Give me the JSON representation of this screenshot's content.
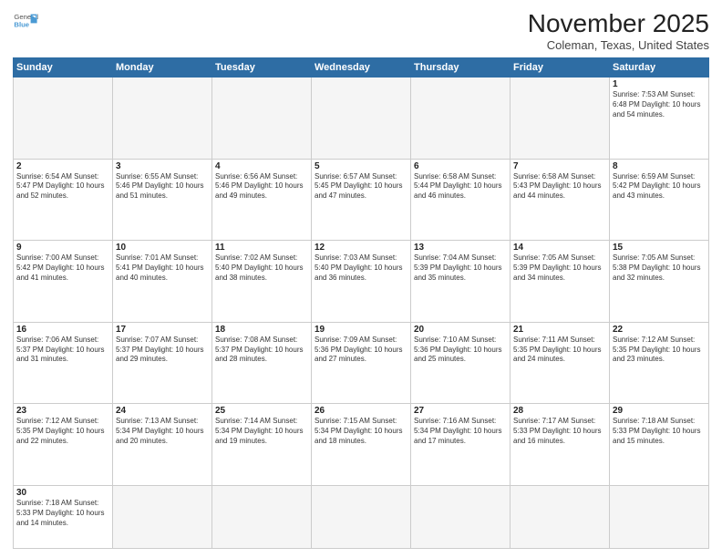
{
  "header": {
    "logo_general": "General",
    "logo_blue": "Blue",
    "title": "November 2025",
    "subtitle": "Coleman, Texas, United States"
  },
  "days_of_week": [
    "Sunday",
    "Monday",
    "Tuesday",
    "Wednesday",
    "Thursday",
    "Friday",
    "Saturday"
  ],
  "weeks": [
    [
      {
        "day": "",
        "info": ""
      },
      {
        "day": "",
        "info": ""
      },
      {
        "day": "",
        "info": ""
      },
      {
        "day": "",
        "info": ""
      },
      {
        "day": "",
        "info": ""
      },
      {
        "day": "",
        "info": ""
      },
      {
        "day": "1",
        "info": "Sunrise: 7:53 AM\nSunset: 6:48 PM\nDaylight: 10 hours\nand 54 minutes."
      }
    ],
    [
      {
        "day": "2",
        "info": "Sunrise: 6:54 AM\nSunset: 5:47 PM\nDaylight: 10 hours\nand 52 minutes."
      },
      {
        "day": "3",
        "info": "Sunrise: 6:55 AM\nSunset: 5:46 PM\nDaylight: 10 hours\nand 51 minutes."
      },
      {
        "day": "4",
        "info": "Sunrise: 6:56 AM\nSunset: 5:46 PM\nDaylight: 10 hours\nand 49 minutes."
      },
      {
        "day": "5",
        "info": "Sunrise: 6:57 AM\nSunset: 5:45 PM\nDaylight: 10 hours\nand 47 minutes."
      },
      {
        "day": "6",
        "info": "Sunrise: 6:58 AM\nSunset: 5:44 PM\nDaylight: 10 hours\nand 46 minutes."
      },
      {
        "day": "7",
        "info": "Sunrise: 6:58 AM\nSunset: 5:43 PM\nDaylight: 10 hours\nand 44 minutes."
      },
      {
        "day": "8",
        "info": "Sunrise: 6:59 AM\nSunset: 5:42 PM\nDaylight: 10 hours\nand 43 minutes."
      }
    ],
    [
      {
        "day": "9",
        "info": "Sunrise: 7:00 AM\nSunset: 5:42 PM\nDaylight: 10 hours\nand 41 minutes."
      },
      {
        "day": "10",
        "info": "Sunrise: 7:01 AM\nSunset: 5:41 PM\nDaylight: 10 hours\nand 40 minutes."
      },
      {
        "day": "11",
        "info": "Sunrise: 7:02 AM\nSunset: 5:40 PM\nDaylight: 10 hours\nand 38 minutes."
      },
      {
        "day": "12",
        "info": "Sunrise: 7:03 AM\nSunset: 5:40 PM\nDaylight: 10 hours\nand 36 minutes."
      },
      {
        "day": "13",
        "info": "Sunrise: 7:04 AM\nSunset: 5:39 PM\nDaylight: 10 hours\nand 35 minutes."
      },
      {
        "day": "14",
        "info": "Sunrise: 7:05 AM\nSunset: 5:39 PM\nDaylight: 10 hours\nand 34 minutes."
      },
      {
        "day": "15",
        "info": "Sunrise: 7:05 AM\nSunset: 5:38 PM\nDaylight: 10 hours\nand 32 minutes."
      }
    ],
    [
      {
        "day": "16",
        "info": "Sunrise: 7:06 AM\nSunset: 5:37 PM\nDaylight: 10 hours\nand 31 minutes."
      },
      {
        "day": "17",
        "info": "Sunrise: 7:07 AM\nSunset: 5:37 PM\nDaylight: 10 hours\nand 29 minutes."
      },
      {
        "day": "18",
        "info": "Sunrise: 7:08 AM\nSunset: 5:37 PM\nDaylight: 10 hours\nand 28 minutes."
      },
      {
        "day": "19",
        "info": "Sunrise: 7:09 AM\nSunset: 5:36 PM\nDaylight: 10 hours\nand 27 minutes."
      },
      {
        "day": "20",
        "info": "Sunrise: 7:10 AM\nSunset: 5:36 PM\nDaylight: 10 hours\nand 25 minutes."
      },
      {
        "day": "21",
        "info": "Sunrise: 7:11 AM\nSunset: 5:35 PM\nDaylight: 10 hours\nand 24 minutes."
      },
      {
        "day": "22",
        "info": "Sunrise: 7:12 AM\nSunset: 5:35 PM\nDaylight: 10 hours\nand 23 minutes."
      }
    ],
    [
      {
        "day": "23",
        "info": "Sunrise: 7:12 AM\nSunset: 5:35 PM\nDaylight: 10 hours\nand 22 minutes."
      },
      {
        "day": "24",
        "info": "Sunrise: 7:13 AM\nSunset: 5:34 PM\nDaylight: 10 hours\nand 20 minutes."
      },
      {
        "day": "25",
        "info": "Sunrise: 7:14 AM\nSunset: 5:34 PM\nDaylight: 10 hours\nand 19 minutes."
      },
      {
        "day": "26",
        "info": "Sunrise: 7:15 AM\nSunset: 5:34 PM\nDaylight: 10 hours\nand 18 minutes."
      },
      {
        "day": "27",
        "info": "Sunrise: 7:16 AM\nSunset: 5:34 PM\nDaylight: 10 hours\nand 17 minutes."
      },
      {
        "day": "28",
        "info": "Sunrise: 7:17 AM\nSunset: 5:33 PM\nDaylight: 10 hours\nand 16 minutes."
      },
      {
        "day": "29",
        "info": "Sunrise: 7:18 AM\nSunset: 5:33 PM\nDaylight: 10 hours\nand 15 minutes."
      }
    ],
    [
      {
        "day": "30",
        "info": "Sunrise: 7:18 AM\nSunset: 5:33 PM\nDaylight: 10 hours\nand 14 minutes."
      },
      {
        "day": "",
        "info": ""
      },
      {
        "day": "",
        "info": ""
      },
      {
        "day": "",
        "info": ""
      },
      {
        "day": "",
        "info": ""
      },
      {
        "day": "",
        "info": ""
      },
      {
        "day": "",
        "info": ""
      }
    ]
  ]
}
